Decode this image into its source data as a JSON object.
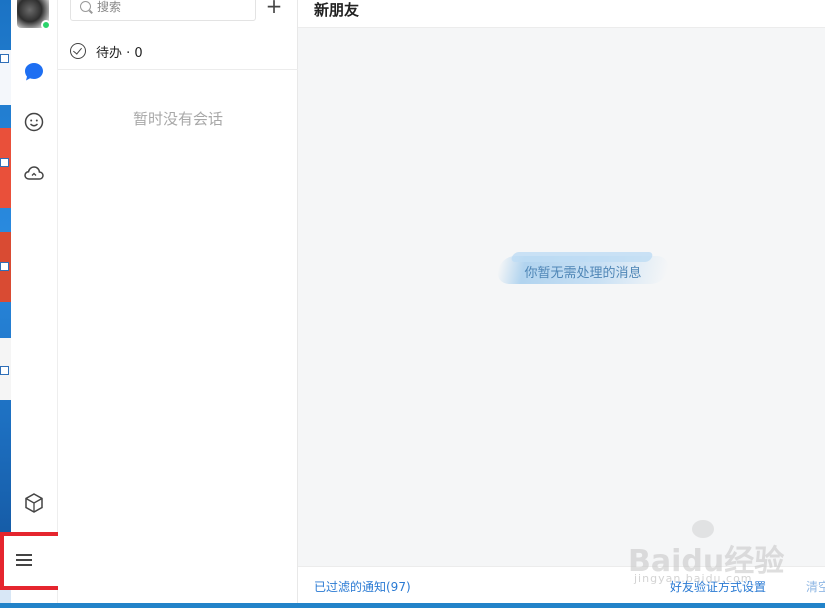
{
  "search": {
    "placeholder": "搜索"
  },
  "conversations": {
    "add_label": "+",
    "todo_label": "待办 · 0",
    "empty_text": "暂时没有会话"
  },
  "main": {
    "title": "新朋友",
    "empty_message": "你暂无需处理的消息",
    "footer": {
      "filtered_link": "已过滤的通知(97)",
      "verify_link": "好友验证方式设置",
      "clear_link": "清空"
    }
  },
  "rail": {
    "icons": [
      "chat-bubble-icon",
      "contacts-icon",
      "cloud-icon",
      "cube-icon",
      "menu-icon"
    ],
    "accent_color": "#1e6ff2",
    "status_color": "#2bd46b",
    "highlight_color": "#e5252e"
  },
  "watermark": {
    "text": "Baidu经验",
    "sub": "jingyan.baidu.com"
  }
}
